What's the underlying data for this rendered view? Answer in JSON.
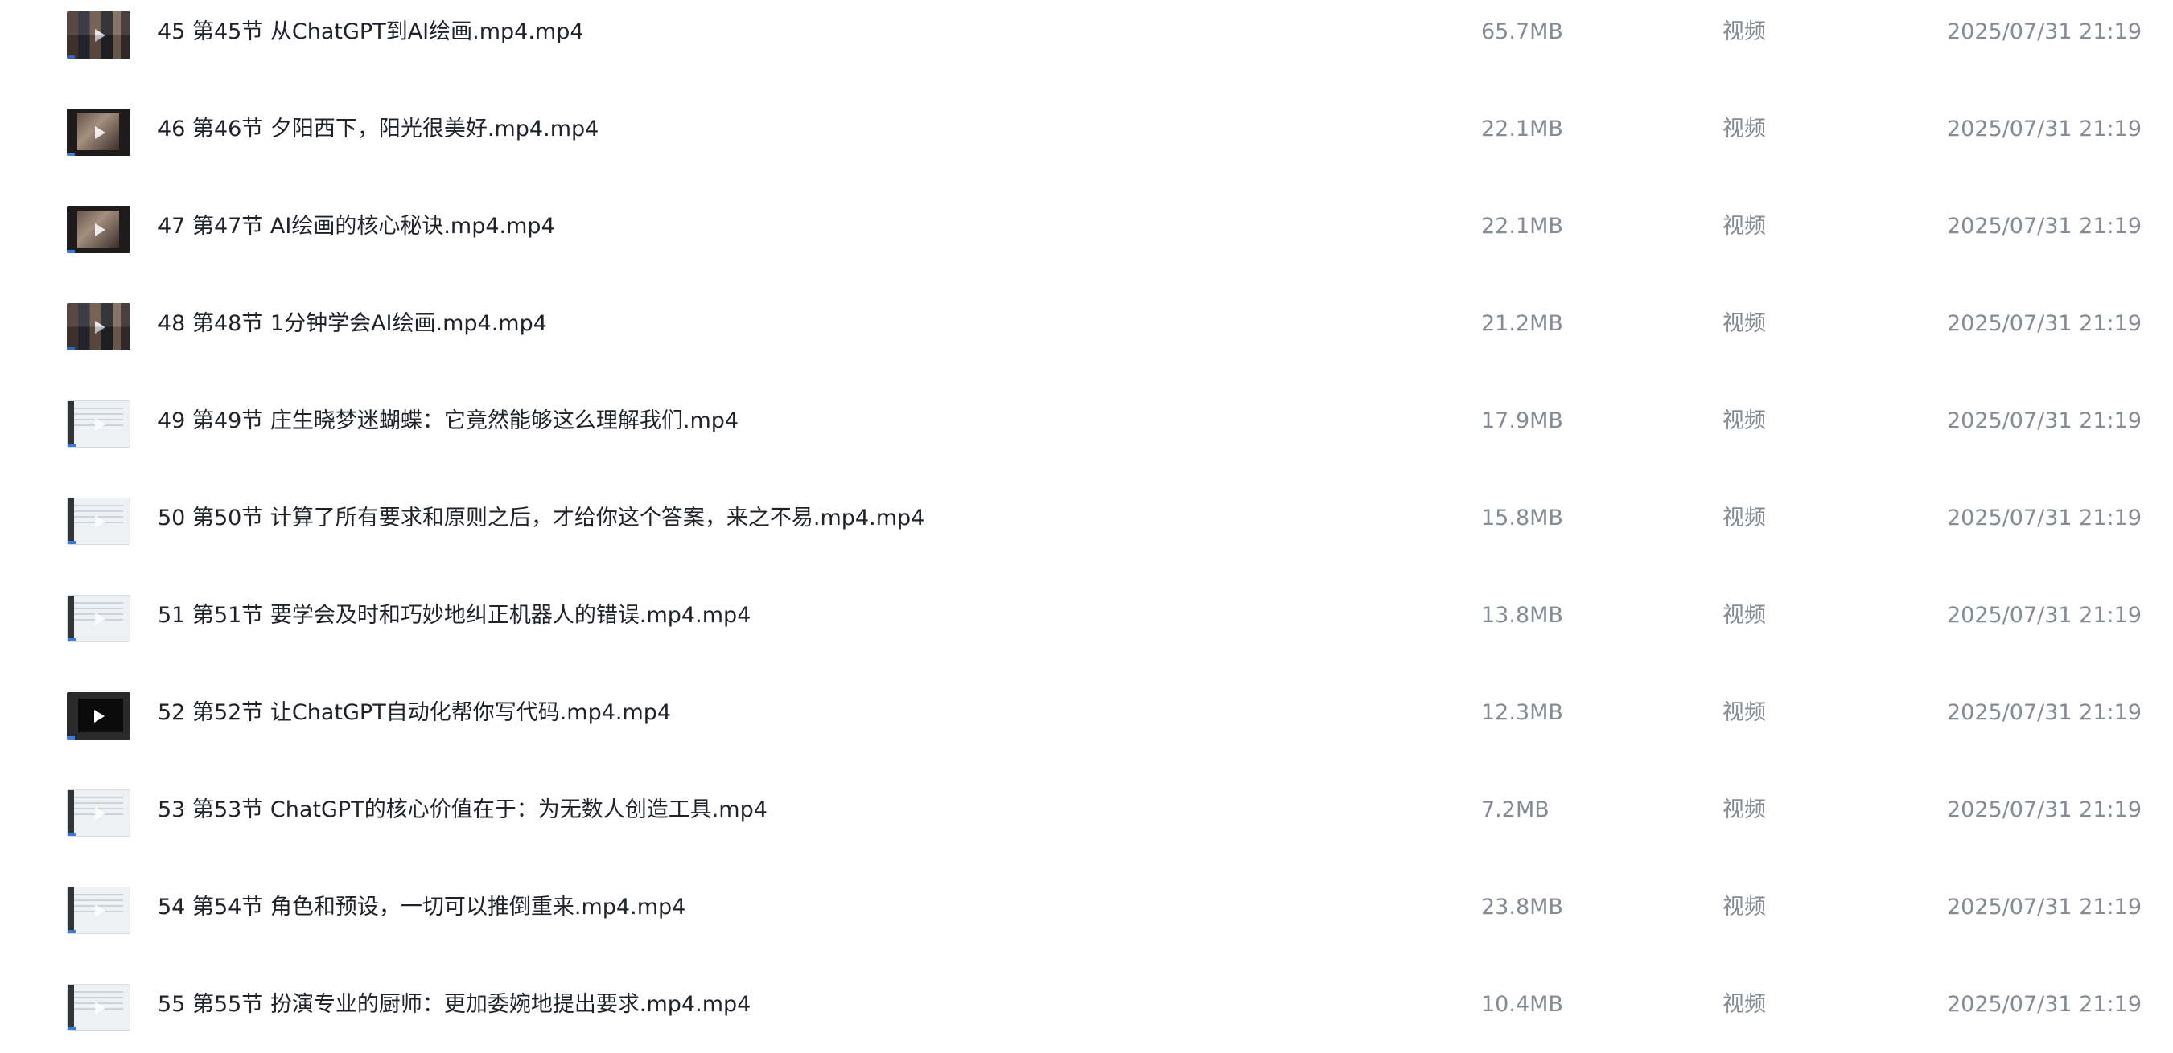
{
  "file_list": {
    "rows": [
      {
        "index": "45",
        "section": "第45节",
        "title": "从ChatGPT到AI绘画.mp4.mp4",
        "size": "65.7MB",
        "type": "视频",
        "date": "2025/07/31 21:19",
        "thumb_style": "collage",
        "icon": "video-thumbnail-icon"
      },
      {
        "index": "46",
        "section": "第46节",
        "title": "夕阳西下，阳光很美好.mp4.mp4",
        "size": "22.1MB",
        "type": "视频",
        "date": "2025/07/31 21:19",
        "thumb_style": "portrait",
        "icon": "video-thumbnail-icon"
      },
      {
        "index": "47",
        "section": "第47节",
        "title": "AI绘画的核心秘诀.mp4.mp4",
        "size": "22.1MB",
        "type": "视频",
        "date": "2025/07/31 21:19",
        "thumb_style": "portrait",
        "icon": "video-thumbnail-icon"
      },
      {
        "index": "48",
        "section": "第48节",
        "title": "1分钟学会AI绘画.mp4.mp4",
        "size": "21.2MB",
        "type": "视频",
        "date": "2025/07/31 21:19",
        "thumb_style": "collage",
        "icon": "video-thumbnail-icon"
      },
      {
        "index": "49",
        "section": "第49节",
        "title": "庄生晓梦迷蝴蝶：它竟然能够这么理解我们.mp4",
        "size": "17.9MB",
        "type": "视频",
        "date": "2025/07/31 21:19",
        "thumb_style": "light",
        "icon": "video-thumbnail-icon"
      },
      {
        "index": "50",
        "section": "第50节",
        "title": "计算了所有要求和原则之后，才给你这个答案，来之不易.mp4.mp4",
        "size": "15.8MB",
        "type": "视频",
        "date": "2025/07/31 21:19",
        "thumb_style": "light",
        "icon": "video-thumbnail-icon"
      },
      {
        "index": "51",
        "section": "第51节",
        "title": "要学会及时和巧妙地纠正机器人的错误.mp4.mp4",
        "size": "13.8MB",
        "type": "视频",
        "date": "2025/07/31 21:19",
        "thumb_style": "light",
        "icon": "video-thumbnail-icon"
      },
      {
        "index": "52",
        "section": "第52节",
        "title": "让ChatGPT自动化帮你写代码.mp4.mp4",
        "size": "12.3MB",
        "type": "视频",
        "date": "2025/07/31 21:19",
        "thumb_style": "blank-dark",
        "icon": "video-thumbnail-icon"
      },
      {
        "index": "53",
        "section": "第53节",
        "title": "ChatGPT的核心价值在于：为无数人创造工具.mp4",
        "size": "7.2MB",
        "type": "视频",
        "date": "2025/07/31 21:19",
        "thumb_style": "light",
        "icon": "video-thumbnail-icon"
      },
      {
        "index": "54",
        "section": "第54节",
        "title": "角色和预设，一切可以推倒重来.mp4.mp4",
        "size": "23.8MB",
        "type": "视频",
        "date": "2025/07/31 21:19",
        "thumb_style": "light",
        "icon": "video-thumbnail-icon"
      },
      {
        "index": "55",
        "section": "第55节",
        "title": "扮演专业的厨师：更加委婉地提出要求.mp4.mp4",
        "size": "10.4MB",
        "type": "视频",
        "date": "2025/07/31 21:19",
        "thumb_style": "light",
        "icon": "video-thumbnail-icon"
      }
    ]
  }
}
